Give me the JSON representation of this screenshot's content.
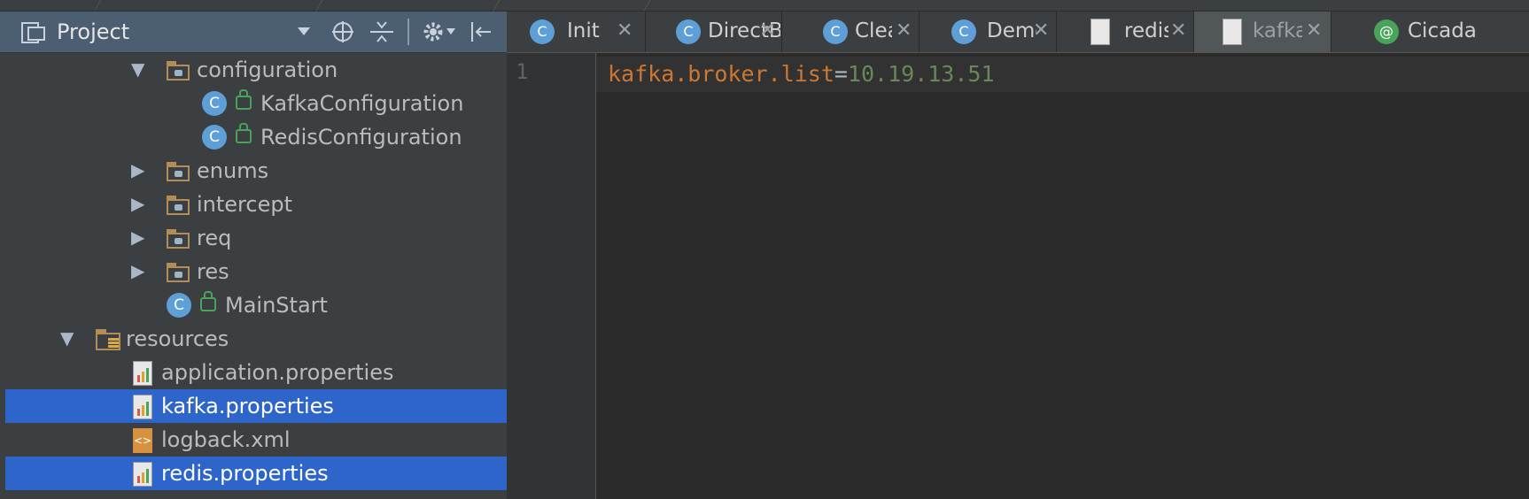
{
  "project_panel": {
    "title": "Project",
    "tree": [
      {
        "label": "configuration",
        "type": "folder",
        "expanded": true
      },
      {
        "label": "KafkaConfiguration",
        "type": "class"
      },
      {
        "label": "RedisConfiguration",
        "type": "class"
      },
      {
        "label": "enums",
        "type": "folder",
        "expanded": false
      },
      {
        "label": "intercept",
        "type": "folder",
        "expanded": false
      },
      {
        "label": "req",
        "type": "folder",
        "expanded": false
      },
      {
        "label": "res",
        "type": "folder",
        "expanded": false
      },
      {
        "label": "MainStart",
        "type": "class"
      },
      {
        "label": "resources",
        "type": "resource-folder",
        "expanded": true
      },
      {
        "label": "application.properties",
        "type": "properties"
      },
      {
        "label": "kafka.properties",
        "type": "properties",
        "selected": true
      },
      {
        "label": "logback.xml",
        "type": "xml"
      },
      {
        "label": "redis.properties",
        "type": "properties",
        "selected": true
      }
    ]
  },
  "editor": {
    "tabs": [
      {
        "label": "InitS",
        "icon": "class-icon"
      },
      {
        "label": "DirectBy",
        "icon": "class-icon"
      },
      {
        "label": "Clea",
        "icon": "class-icon"
      },
      {
        "label": "Demo",
        "icon": "class-icon"
      },
      {
        "label": "redis.",
        "icon": "properties-icon"
      },
      {
        "label": "kafka.",
        "icon": "properties-icon",
        "active": true
      },
      {
        "label": "Cicada",
        "icon": "annotation-icon"
      }
    ],
    "lines": [
      {
        "number": "1",
        "key": "kafka.broker.list",
        "eq": "=",
        "value": "10.19.13.51"
      }
    ]
  },
  "colors": {
    "selection": "#2e65ca",
    "key": "#cc7832",
    "value": "#6a8759"
  }
}
